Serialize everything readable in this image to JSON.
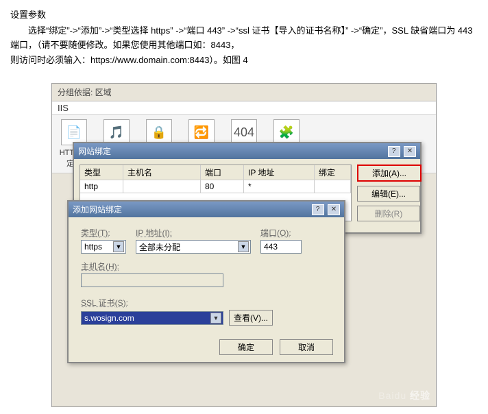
{
  "doc": {
    "heading": "设置参数",
    "line1": "选择“绑定”->“添加”->“类型选择 https” ->“端口 443” ->“ssl 证书【导入的证书名称】” ->“确定”，SSL 缺省端口为 443 端口，（请不要随便修改。如果您使用其他端口如：8443，",
    "line2": "则访问时必须输入：https://www.domain.com:8443）。如图 4"
  },
  "iis": {
    "topLabel": "分组依据: 区域",
    "groupHeader": "IIS",
    "toolbar": [
      "HTTP 重定向",
      "MIME 类型",
      "SSL 设置",
      "处理程序映射",
      "错误页",
      "模块"
    ]
  },
  "bindWin": {
    "title": "网站绑定",
    "cols": [
      "类型",
      "主机名",
      "端口",
      "IP 地址",
      "绑定"
    ],
    "rows": [
      {
        "type": "http",
        "host": "",
        "port": "80",
        "ip": "*"
      }
    ],
    "btnAdd": "添加(A)...",
    "btnEdit": "编辑(E)...",
    "btnDelete": "删除(R)"
  },
  "addWin": {
    "title": "添加网站绑定",
    "labelType": "类型(T):",
    "valueType": "https",
    "labelIp": "IP 地址(I):",
    "valueIp": "全部未分配",
    "labelPort": "端口(O):",
    "valuePort": "443",
    "labelHost": "主机名(H):",
    "labelSsl": "SSL 证书(S):",
    "valueSsl": "s.wosign.com",
    "btnView": "查看(V)...",
    "btnOk": "确定",
    "btnCancel": "取消"
  },
  "watermark": {
    "brand": "Baidu",
    "sub": "经验"
  }
}
